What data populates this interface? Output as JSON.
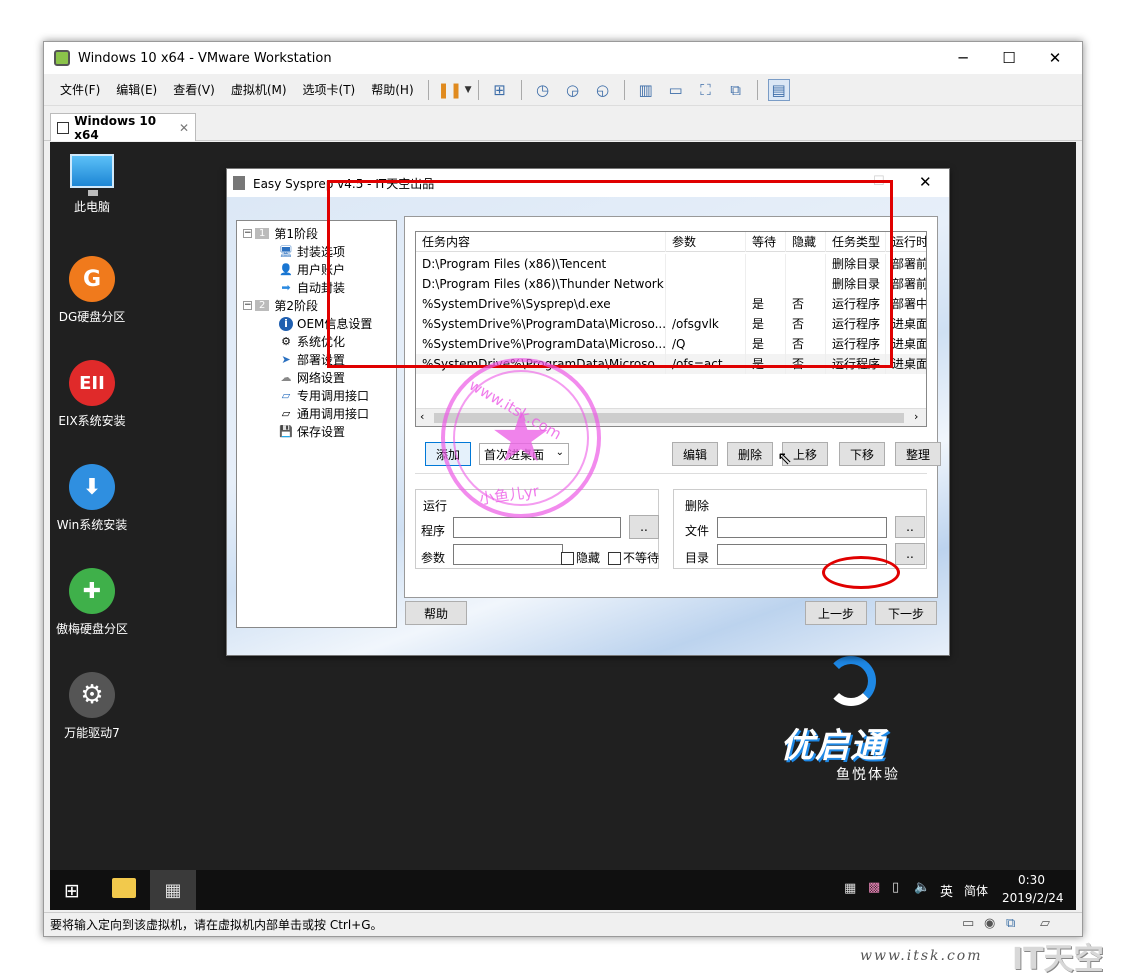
{
  "vm": {
    "title": "Windows 10 x64 - VMware Workstation",
    "menu": [
      "文件(F)",
      "编辑(E)",
      "查看(V)",
      "虚拟机(M)",
      "选项卡(T)",
      "帮助(H)"
    ],
    "tab_label": "Windows 10 x64",
    "status_text": "要将输入定向到该虚拟机，请在虚拟机内部单击或按 Ctrl+G。"
  },
  "desktop_icons": [
    {
      "label": "此电脑",
      "icon": "monitor-icon",
      "color": "#3aa0e8"
    },
    {
      "label": "DG硬盘分区",
      "icon": "dg-icon",
      "glyph": "G",
      "color": "#f07a1c"
    },
    {
      "label": "EIX系统安装",
      "icon": "eix-icon",
      "glyph": "EII",
      "color": "#e02a2a"
    },
    {
      "label": "Win系统安装",
      "icon": "download-icon",
      "glyph": "⬇",
      "color": "#2f8fe0"
    },
    {
      "label": "傲梅硬盘分区",
      "icon": "pie-icon",
      "glyph": "✚",
      "color": "#3fb04a"
    },
    {
      "label": "万能驱动7",
      "icon": "gear-icon",
      "glyph": "⚙",
      "color": "#555"
    }
  ],
  "brand": {
    "name": "优启通",
    "tagline": "鱼悦体验",
    "color": "#1e88e5"
  },
  "taskbar": {
    "ime_lang": "英",
    "ime_mode": "简体",
    "time": "0:30",
    "date": "2019/2/24"
  },
  "dialog": {
    "title": "Easy Sysprep v4.5 - IT天空出品",
    "tree": [
      {
        "num": "1",
        "label": "第1阶段",
        "children": [
          "封装选项",
          "用户账户",
          "自动封装"
        ]
      },
      {
        "num": "2",
        "label": "第2阶段",
        "children": [
          "OEM信息设置",
          "系统优化",
          "部署设置",
          "网络设置",
          "专用调用接口",
          "通用调用接口",
          "保存设置"
        ]
      }
    ],
    "columns": [
      "任务内容",
      "参数",
      "等待",
      "隐藏",
      "任务类型",
      "运行时"
    ],
    "rows": [
      [
        "D:\\Program Files (x86)\\Tencent",
        "",
        "",
        "",
        "删除目录",
        "部署前"
      ],
      [
        "D:\\Program Files (x86)\\Thunder Network",
        "",
        "",
        "",
        "删除目录",
        "部署前"
      ],
      [
        "%SystemDrive%\\Sysprep\\d.exe",
        "",
        "是",
        "否",
        "运行程序",
        "部署中"
      ],
      [
        "%SystemDrive%\\ProgramData\\Microso...",
        "/ofsgvlk",
        "是",
        "否",
        "运行程序",
        "进桌面"
      ],
      [
        "%SystemDrive%\\ProgramData\\Microso...",
        "/Q",
        "是",
        "否",
        "运行程序",
        "进桌面"
      ],
      [
        "%SystemDrive%\\ProgramData\\Microso...",
        "/ofs=act",
        "是",
        "否",
        "运行程序",
        "进桌面"
      ]
    ],
    "buttons": {
      "add": "添加",
      "timing": "首次进桌面",
      "edit": "编辑",
      "delete": "删除",
      "up": "上移",
      "down": "下移",
      "tidy": "整理",
      "help": "帮助",
      "prev": "上一步",
      "next": "下一步",
      "browse": ".."
    },
    "run_group": {
      "title": "运行",
      "program": "程序",
      "params": "参数",
      "hidden": "隐藏",
      "nowait": "不等待"
    },
    "delete_group": {
      "title": "删除",
      "file": "文件",
      "dir": "目录"
    }
  },
  "watermark": {
    "site": "www.itsk.com",
    "user": "小鱼儿yr",
    "brand": "IT天空",
    "footer_site": "www.itsk.com"
  }
}
